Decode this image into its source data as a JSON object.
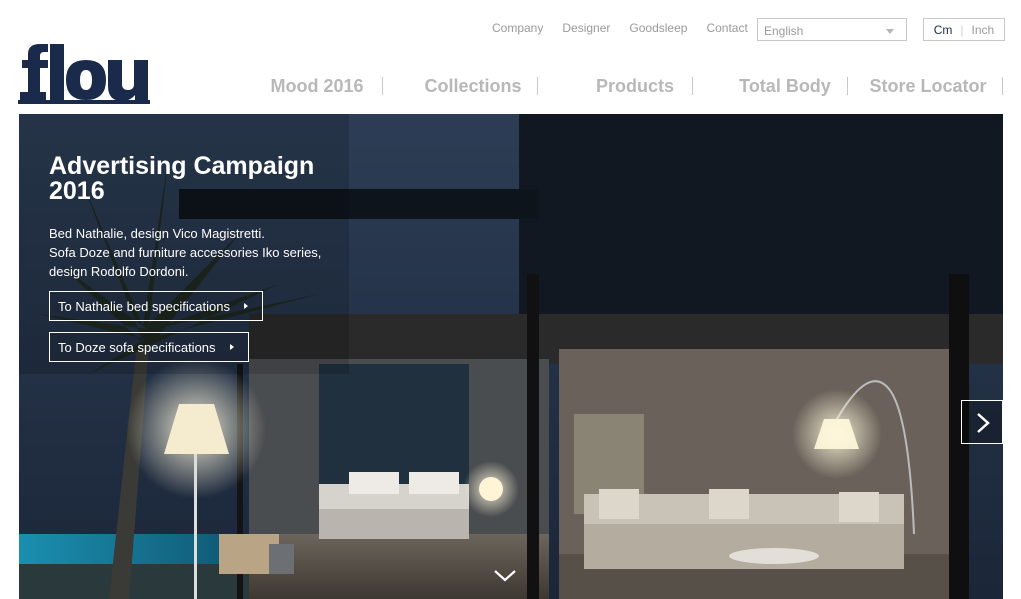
{
  "brand": {
    "logo_text": "flou",
    "logo_color": "#1a2a4a"
  },
  "utility_nav": {
    "links": [
      "Company",
      "Designer",
      "Goodsleep",
      "Contact"
    ]
  },
  "language": {
    "selected": "English",
    "icon": "chevron-down-icon"
  },
  "units": {
    "cm": "Cm",
    "inch": "Inch",
    "active": "Cm"
  },
  "main_nav": {
    "items": [
      "Mood 2016",
      "Collections",
      "Products",
      "Total Body",
      "Store Locator"
    ],
    "color": "#b8b8b8"
  },
  "hero": {
    "title_line1": "Advertising Campaign",
    "title_line2": "2016",
    "desc_line1": "Bed Nathalie, design Vico Magistretti.",
    "desc_line2": "Sofa Doze and furniture accessories Iko series,",
    "desc_line3": "design Rodolfo Dordoni.",
    "cta1": "To Nathalie bed specifications",
    "cta2": "To Doze sofa specifications",
    "next_icon": "chevron-right-icon",
    "down_icon": "chevron-down-icon"
  }
}
